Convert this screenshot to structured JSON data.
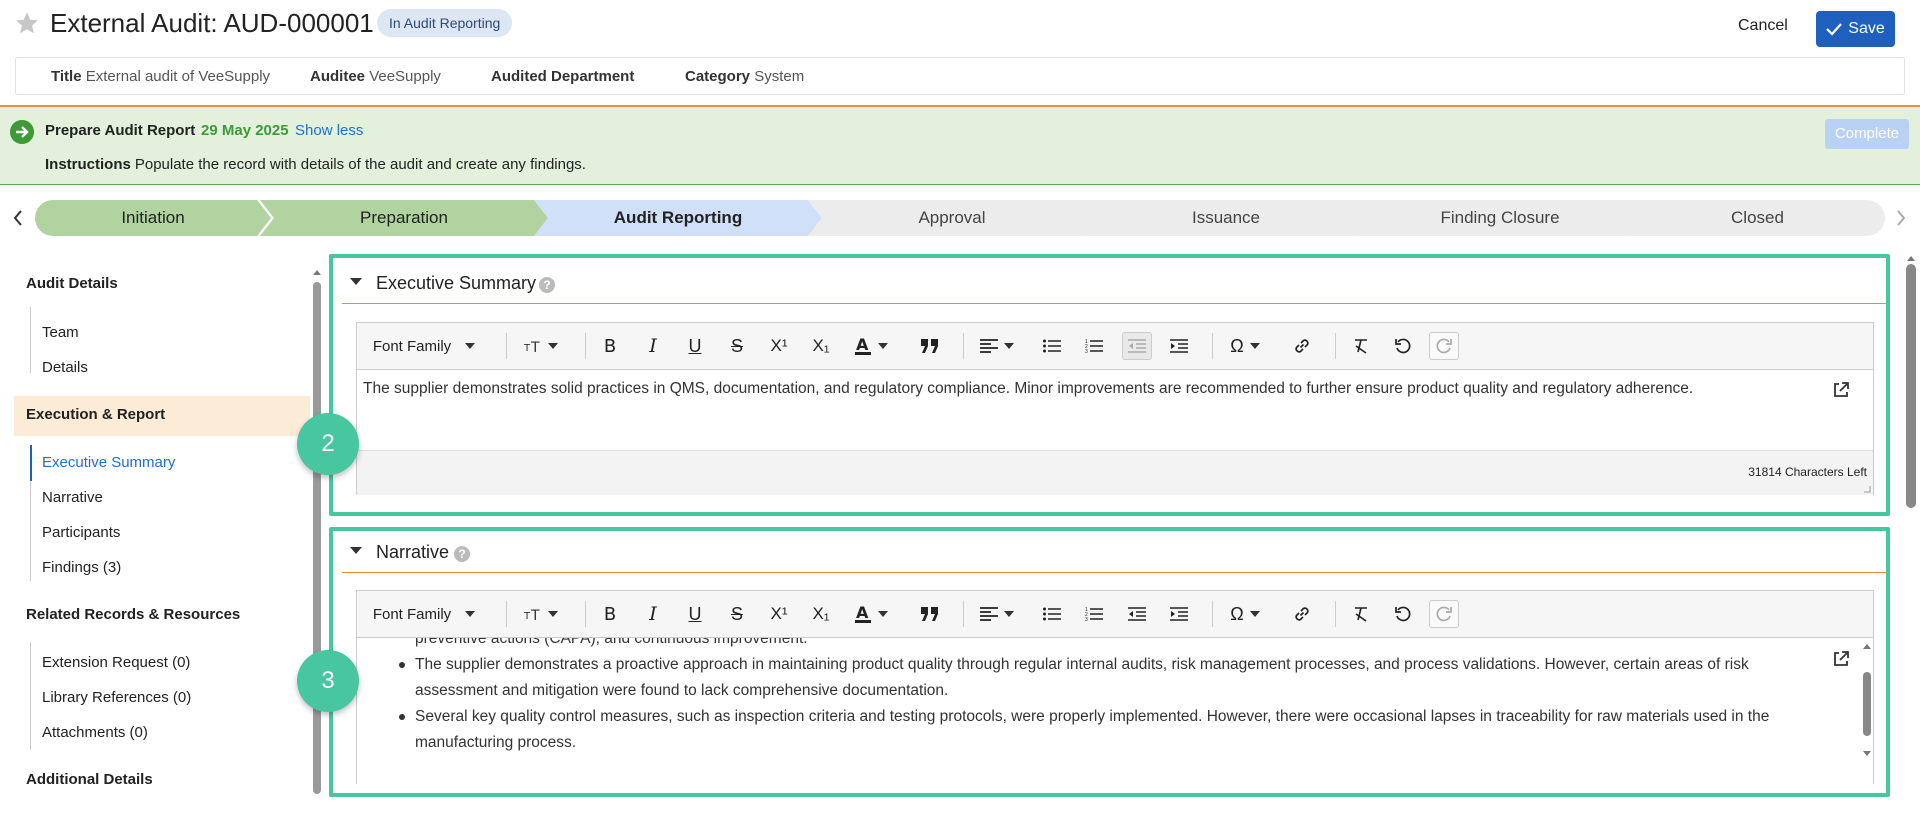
{
  "header": {
    "title": "External Audit: AUD-000001",
    "status": "In Audit Reporting",
    "cancel_label": "Cancel",
    "save_label": "Save"
  },
  "summary": {
    "fields": [
      {
        "label": "Title",
        "value": "External audit of VeeSupply"
      },
      {
        "label": "Auditee",
        "value": "VeeSupply"
      },
      {
        "label": "Audited Department",
        "value": ""
      },
      {
        "label": "Category",
        "value": "System"
      }
    ]
  },
  "task": {
    "name": "Prepare Audit Report",
    "date": "29 May 2025",
    "toggle_label": "Show less",
    "instructions_label": "Instructions",
    "instructions_text": "Populate the record with details of the audit and create any findings.",
    "complete_label": "Complete"
  },
  "stages": [
    {
      "label": "Initiation",
      "state": "done"
    },
    {
      "label": "Preparation",
      "state": "done"
    },
    {
      "label": "Audit Reporting",
      "state": "current"
    },
    {
      "label": "Approval",
      "state": "todo"
    },
    {
      "label": "Issuance",
      "state": "todo"
    },
    {
      "label": "Finding Closure",
      "state": "todo"
    },
    {
      "label": "Closed",
      "state": "todo"
    }
  ],
  "stage_colors": {
    "done": "#b0d3a0",
    "current": "#cfe0f8",
    "todo": "#ececec"
  },
  "nav": {
    "audit_details": "Audit Details",
    "team": "Team",
    "details": "Details",
    "execution_report": "Execution & Report",
    "executive_summary": "Executive Summary",
    "narrative": "Narrative",
    "participants": "Participants",
    "findings": "Findings (3)",
    "related": "Related Records & Resources",
    "extension_request": "Extension Request (0)",
    "library_references": "Library References (0)",
    "attachments": "Attachments (0)",
    "additional_details": "Additional Details"
  },
  "toolbar": {
    "font_family": "Font Family"
  },
  "exec_summary": {
    "title": "Executive Summary",
    "help": "?",
    "text": "The supplier demonstrates solid practices in QMS, documentation, and regulatory compliance. Minor improvements are recommended to further ensure product quality and regulatory adherence.",
    "chars_left": "31814 Characters Left",
    "badge": "2"
  },
  "narrative": {
    "title": "Narrative",
    "help": "?",
    "partial_line": "preventive actions (CAPA), and continuous improvement.",
    "bullets": [
      "The supplier demonstrates a proactive approach in maintaining product quality through regular internal audits, risk management processes, and process validations. However, certain areas of risk assessment and mitigation were found to lack comprehensive documentation.",
      "Several key quality control measures, such as inspection criteria and testing protocols, were properly implemented. However, there were occasional lapses in traceability for raw materials used in the manufacturing process."
    ],
    "badge": "3"
  },
  "colors": {
    "accent_teal": "#47c6a0",
    "primary_blue": "#1f5fbd",
    "link_blue": "#1f6fd0",
    "task_green": "#3d9a37",
    "orange_rule": "#e98a3c"
  }
}
